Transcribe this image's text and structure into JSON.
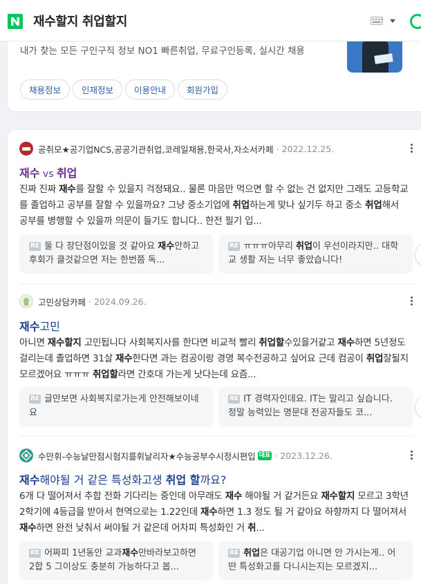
{
  "header": {
    "query": "재수할지 취업할지",
    "logo": "N",
    "icons": [
      "keyboard-icon",
      "chevron-down-icon",
      "search-icon"
    ]
  },
  "ad": {
    "description": "내가 찾는 모든 구인구직 정보 NO1 빠른취업, 무료구인등록, 실시간 채용",
    "links": [
      "채용정보",
      "인재정보",
      "이용안내",
      "회원가입"
    ]
  },
  "posts": [
    {
      "source": "공취모★공기업NCS,공공기관취업,코레일채용,한국사,자소서카페",
      "date": "2022.12.25.",
      "title": [
        "재수",
        " vs ",
        "취업"
      ],
      "snippet": [
        "진짜 진짜 ",
        "재수",
        "를 잘할 수 있을지 걱정돼요.. 물론 마음만 먹으면 할 수 없는 건 없지만 그래도 고등학교를 졸업하고 공부를 잘할 수 있을까요? 그냥 중소기업에 ",
        "취업",
        "하는게 맞나 싶기두 하고 중소 ",
        "취업",
        "해서 공부를 병행할 수 있을까 의문이 들기도 합니다.. 한전 필기 입..."
      ],
      "replies": [
        [
          "RE",
          "둘 다 장단점이있을 것 같아요 ",
          "재수",
          "안하고 후회가 클것같으면 저는 한번쯤 독..."
        ],
        [
          "RE",
          "ㅠㅠㅠ아무리 ",
          "취업",
          "이 우선이라지만.. 대학교 생활 저는 너무 좋았습니다!"
        ]
      ]
    },
    {
      "source": "고민상담카페",
      "date": "2024.09.26.",
      "title": [
        "재수",
        "고민"
      ],
      "snippet": [
        "아니면 ",
        "재수할지",
        " 고민됩니다 사회복지사를 한다면 비교적 빨리 ",
        "취업할",
        "수있을거같고 ",
        "재수",
        "하면 5년정도 걸리는데 졸업하면 31살 ",
        "재수",
        "한다면 과는 컴공이랑 경영 복수전공하고 싶어요 근데 컴공이 ",
        "취업",
        "잘될지 모르겠어요 ㅠㅠㅠ ",
        "취업할",
        "라면 간호대 가는게 낫다는데 요즘..."
      ],
      "replies": [
        [
          "RE",
          "글만보면 사회복지로가는게 안전해보이네요"
        ],
        [
          "RE",
          "IT 경력자인데요. IT는 말리고 싶습니다. 정말 능력있는 명문대 전공자들도 코..."
        ]
      ]
    },
    {
      "source": "수만휘-수능날만점시험지를휘날리자★수능공부수시정시편입",
      "badge": "대표",
      "date": "2023.12.26.",
      "title": [
        "재수",
        "해야될 거 같은 특성화고생 ",
        "취업 할",
        "까요?"
      ],
      "snippet": [
        "6개 다 떨어져서 추합 전화 기다리는 중인데 아무래도 ",
        "재수",
        " 해야될 거 같거든요 ",
        "재수할지",
        " 모르고 3학년 2학기에 4등급을 받아서 현역으로는 1.22인데 ",
        "재수",
        "하면 1.3 정도 될 거 같아요 하향까지 다 떨어져서 ",
        "재수",
        "하면 완전 낮춰서 써야될 거 같은데 어차피 특성화인 거 ",
        "취",
        "..."
      ],
      "replies": [
        [
          "RE",
          "어짜피 1년동안 교과",
          "재수",
          "만바라보고하면 2합 5 그이상도 충분히 가능하다고 봅..."
        ],
        [
          "RE",
          "취업",
          "은 대공기업 아니면 안 가시는게.. 어떤 특성화고를 다니시는지는 모르겠지..."
        ]
      ]
    }
  ],
  "colors": {
    "brand": "#03c75a",
    "link": "#1b3d8f",
    "visited": "#6a2c91"
  }
}
